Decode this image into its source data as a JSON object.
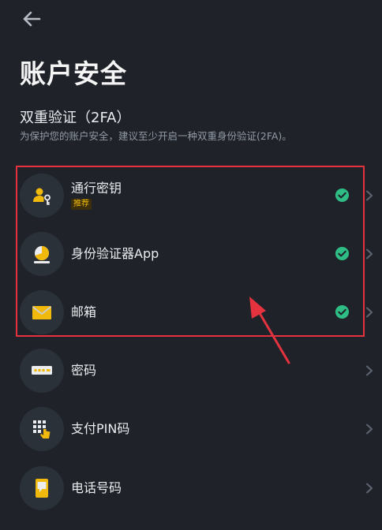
{
  "header": {
    "title": "账户安全"
  },
  "twofa": {
    "heading": "双重验证（2FA）",
    "description": "为保护您的账户安全，建议至少开启一种双重身份验证(2FA)。"
  },
  "methods": [
    {
      "label": "通行密钥",
      "tag": "推荐",
      "enabled": true,
      "icon": "passkey-icon"
    },
    {
      "label": "身份验证器App",
      "enabled": true,
      "icon": "authenticator-icon"
    },
    {
      "label": "邮箱",
      "enabled": true,
      "icon": "email-icon"
    },
    {
      "label": "密码",
      "enabled": false,
      "icon": "password-icon"
    },
    {
      "label": "支付PIN码",
      "enabled": false,
      "icon": "pin-keypad-icon"
    },
    {
      "label": "电话号码",
      "enabled": false,
      "icon": "phone-icon"
    }
  ],
  "colors": {
    "background": "#1f2329",
    "icon_bg": "#2b3139",
    "accent_yellow": "#f0b90b",
    "success_green": "#2ebd85",
    "highlight_red": "#e5323f",
    "muted_text": "#929aa5"
  }
}
